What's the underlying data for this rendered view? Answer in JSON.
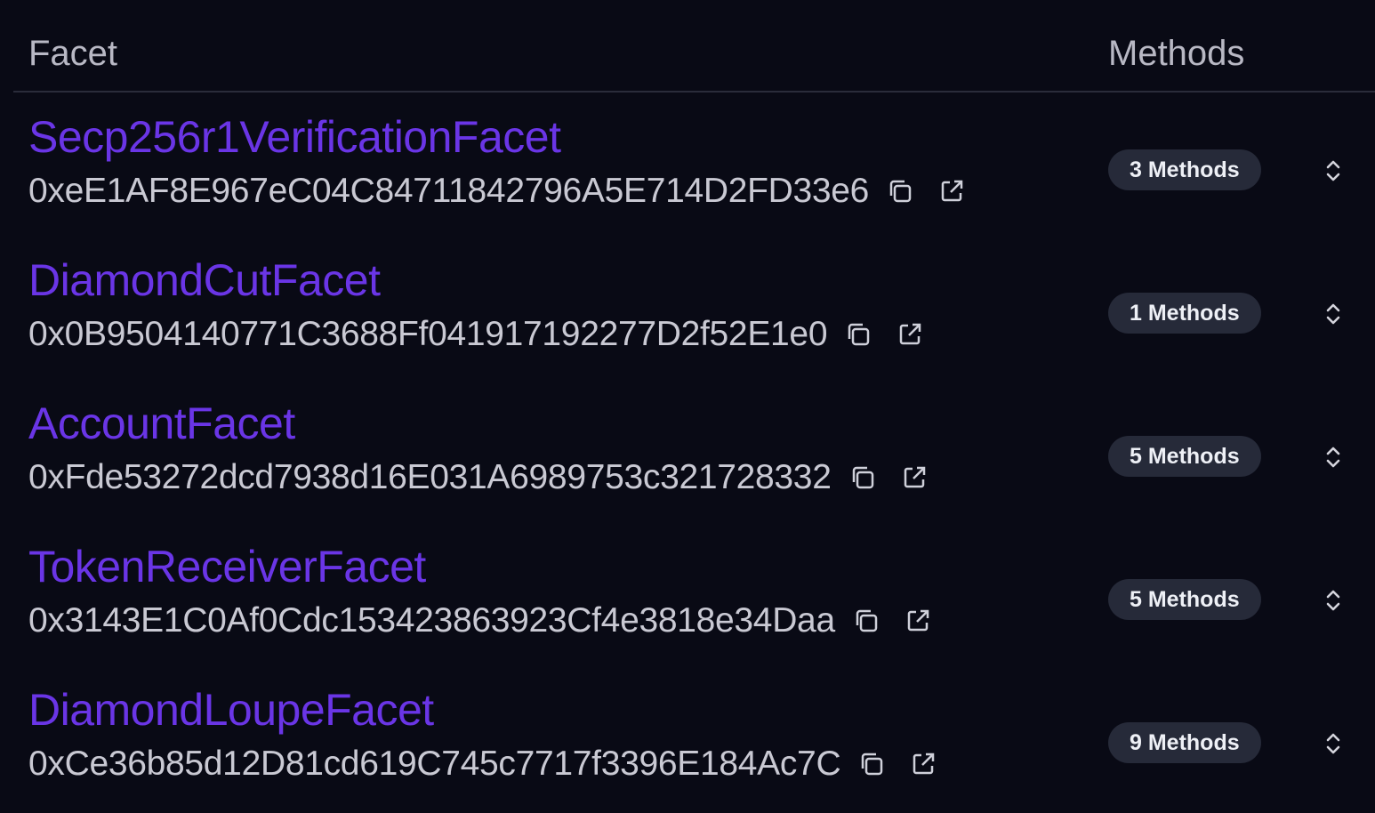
{
  "header": {
    "facet_label": "Facet",
    "methods_label": "Methods"
  },
  "rows": [
    {
      "name": "Secp256r1VerificationFacet",
      "address": "0xeE1AF8E967eC04C84711842796A5E714D2FD33e6",
      "methods": "3 Methods"
    },
    {
      "name": "DiamondCutFacet",
      "address": "0x0B9504140771C3688Ff041917192277D2f52E1e0",
      "methods": "1 Methods"
    },
    {
      "name": "AccountFacet",
      "address": "0xFde53272dcd7938d16E031A6989753c321728332",
      "methods": "5 Methods"
    },
    {
      "name": "TokenReceiverFacet",
      "address": "0x3143E1C0Af0Cdc153423863923Cf4e3818e34Daa",
      "methods": "5 Methods"
    },
    {
      "name": "DiamondLoupeFacet",
      "address": "0xCe36b85d12D81cd619C745c7717f3396E184Ac7C",
      "methods": "9 Methods"
    }
  ],
  "icons": {
    "copy": "copy-icon",
    "external_link": "external-link-icon",
    "expand": "chevron-up-down-icon"
  },
  "colors": {
    "background": "#090a15",
    "facet_name": "#6a35e6",
    "badge_bg": "#262a39"
  }
}
